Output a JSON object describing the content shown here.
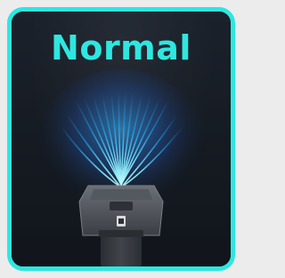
{
  "mode_card": {
    "title": "Normal",
    "selected": true,
    "accent_color": "#2ee7e0",
    "illustration": "vacuum-airflow-icon"
  }
}
